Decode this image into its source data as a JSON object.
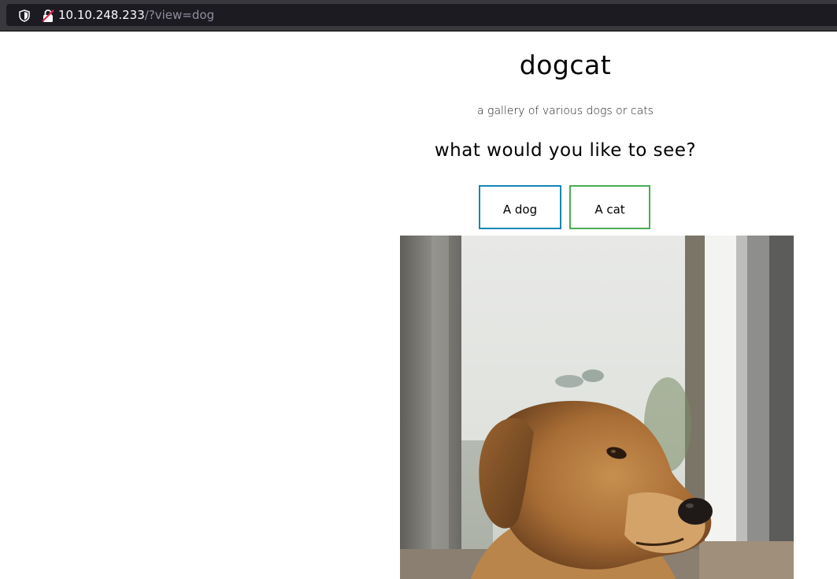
{
  "browser": {
    "url_host": "10.10.248.233",
    "url_path": "/?view=dog",
    "shield_icon": "shield-icon",
    "insecure_lock_icon": "insecure-lock-icon"
  },
  "page": {
    "title": "dogcat",
    "subtitle": "a gallery of various dogs or cats",
    "question": "what would you like to see?",
    "buttons": {
      "dog": "A dog",
      "cat": "A cat"
    },
    "image": {
      "description": "golden retriever photo"
    }
  },
  "colors": {
    "dog_button_border": "#1587b4",
    "cat_button_border": "#4aad55",
    "urlbar_bg": "#38383d"
  }
}
